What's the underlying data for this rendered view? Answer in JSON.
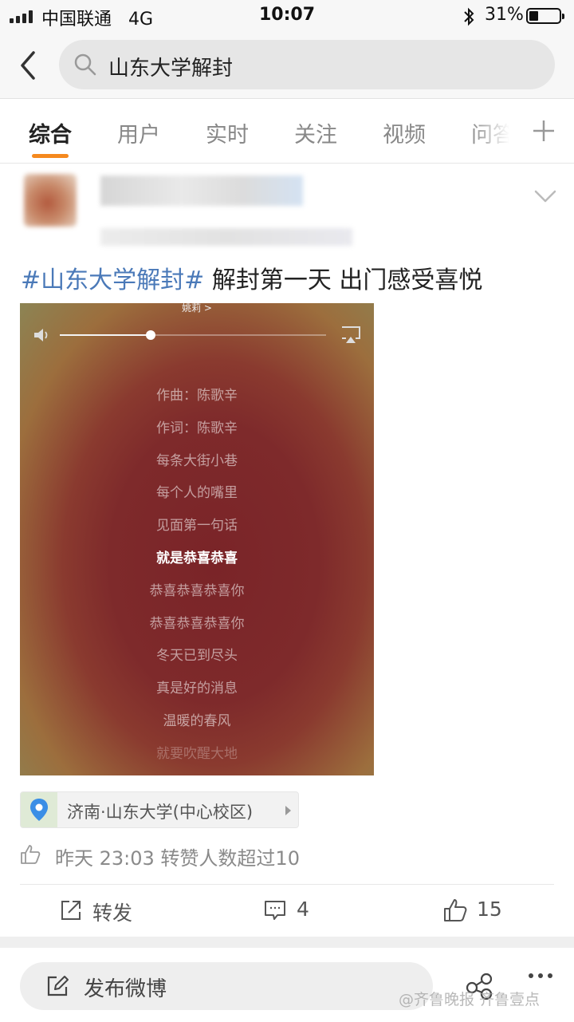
{
  "status_bar": {
    "carrier": "中国联通",
    "network": "4G",
    "time": "10:07",
    "bluetooth_icon": "bluetooth-icon",
    "battery_percent": "31%",
    "battery_level": 0.31
  },
  "search": {
    "query": "山东大学解封",
    "back_icon": "chevron-left-icon",
    "search_icon": "magnifier-icon"
  },
  "tabs": {
    "items": [
      {
        "label": "综合",
        "active": true
      },
      {
        "label": "用户",
        "active": false
      },
      {
        "label": "实时",
        "active": false
      },
      {
        "label": "关注",
        "active": false
      },
      {
        "label": "视频",
        "active": false
      },
      {
        "label": "问答",
        "active": false
      }
    ],
    "add_icon": "plus-icon",
    "accent_color": "#f5891e"
  },
  "post": {
    "hashtag": "#山东大学解封#",
    "text": " 解封第一天 出门感受喜悦",
    "hashtag_color": "#4a79b8",
    "media": {
      "top_label": "姚莉 >",
      "volume_level": 0.34,
      "lyrics": [
        "作曲：陈歌辛",
        "作词：陈歌辛",
        "每条大街小巷",
        "每个人的嘴里",
        "见面第一句话",
        "就是恭喜恭喜",
        "恭喜恭喜恭喜你",
        "恭喜恭喜恭喜你",
        "冬天已到尽头",
        "真是好的消息",
        "温暖的春风",
        "就要吹醒大地"
      ],
      "current_lyric_index": 5
    },
    "location": "济南·山东大学(中心校区)",
    "meta": "昨天 23:03 转赞人数超过10",
    "actions": {
      "repost_label": "转发",
      "comment_count": "4",
      "like_count": "15"
    }
  },
  "bottom_bar": {
    "compose_label": "发布微博",
    "watermark": "@齐鲁晚报 齐鲁壹点"
  }
}
